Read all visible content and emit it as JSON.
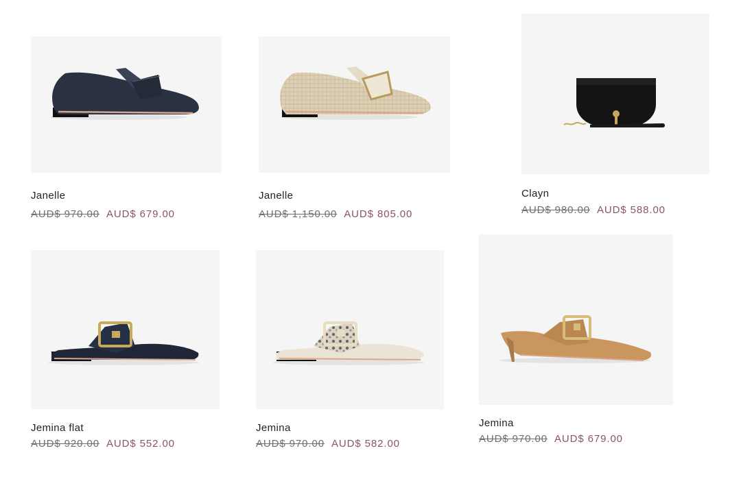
{
  "products": [
    {
      "name": "Janelle",
      "original_price": "AUD$ 970.00",
      "sale_price": "AUD$ 679.00",
      "image": "loafer-navy-icon"
    },
    {
      "name": "Janelle",
      "original_price": "AUD$ 1,150.00",
      "sale_price": "AUD$ 805.00",
      "image": "loafer-woven-beige-icon"
    },
    {
      "name": "Clayn",
      "original_price": "AUD$ 980.00",
      "sale_price": "AUD$ 588.00",
      "image": "black-crossbody-bag-icon"
    },
    {
      "name": "Jemina flat",
      "original_price": "AUD$ 920.00",
      "sale_price": "AUD$ 552.00",
      "image": "buckle-mule-navy-icon"
    },
    {
      "name": "Jemina",
      "original_price": "AUD$ 970.00",
      "sale_price": "AUD$ 582.00",
      "image": "buckle-mule-cream-python-icon"
    },
    {
      "name": "Jemina",
      "original_price": "AUD$ 970.00",
      "sale_price": "AUD$ 679.00",
      "image": "heeled-mule-tan-icon"
    }
  ],
  "colors": {
    "tile_background": "#f5f5f5",
    "sale_price": "#8a5560",
    "original_price": "#6e6e6e",
    "navy_leather": "#2a3242",
    "tan_leather": "#c9975e",
    "cream_leather": "#eae3d6",
    "black_leather": "#141414"
  }
}
